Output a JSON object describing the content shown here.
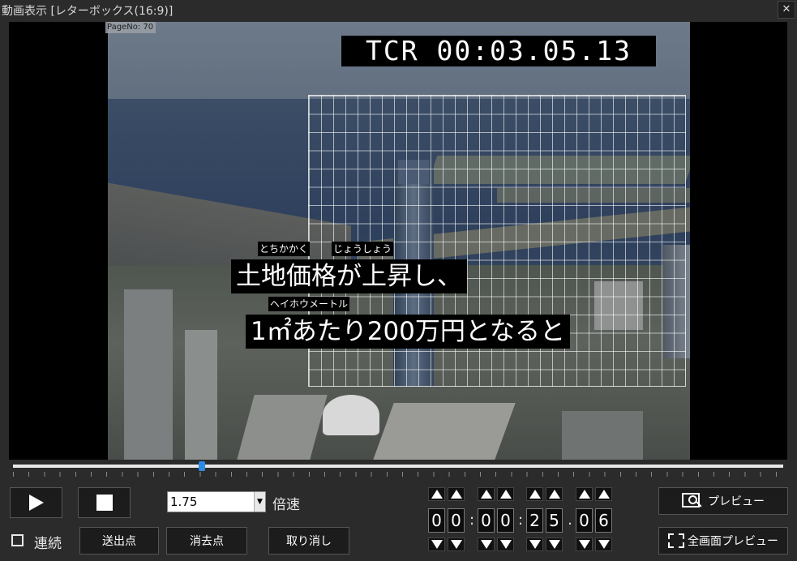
{
  "window": {
    "title": "動画表示 [レターボックス(16:9)]",
    "close_glyph": "✕"
  },
  "video": {
    "page_no": "PageNo: 70",
    "tcr": "TCR 00:03.05.13",
    "subtitle_line1": "土地価格が上昇し、",
    "subtitle_line2": "1㎡あたり200万円となると",
    "ruby1": "とちかかく",
    "ruby2": "じょうしょう",
    "ruby3": "ヘイホウメートル"
  },
  "seek": {
    "position_fraction": 0.245
  },
  "controls": {
    "speed_value": "1.75",
    "speed_label": "倍速",
    "continuous_label": "連続",
    "continuous_checked": false,
    "send_point_label": "送出点",
    "erase_point_label": "消去点",
    "cancel_label": "取り消し",
    "preview_label": "プレビュー",
    "fullscreen_preview_label": "全画面プレビュー"
  },
  "timecode": {
    "digits": [
      "0",
      "0",
      "0",
      "0",
      "2",
      "5",
      "0",
      "6"
    ],
    "separators": [
      ":",
      ":",
      "."
    ]
  },
  "icons": [
    "close-icon",
    "play-icon",
    "stop-icon",
    "dropdown-arrow-icon",
    "preview-magnifier-icon",
    "fullscreen-icon",
    "up-arrow-icon",
    "down-arrow-icon"
  ],
  "colors": {
    "seek_thumb": "#2a8ae6",
    "background": "#2b2b2b"
  }
}
